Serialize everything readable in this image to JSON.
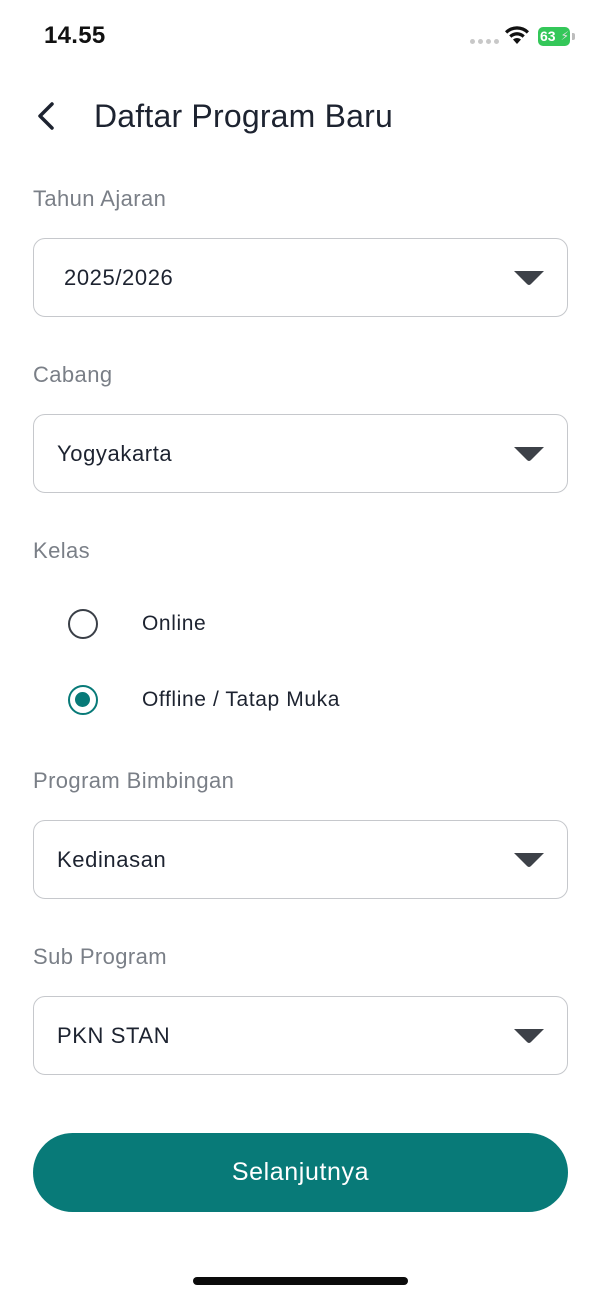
{
  "status_bar": {
    "time": "14.55",
    "battery": "63",
    "icons": [
      "signal-dots-icon",
      "wifi-icon",
      "battery-icon"
    ]
  },
  "header": {
    "back_icon": "chevron-left-icon",
    "title": "Daftar Program Baru"
  },
  "form": {
    "tahun_ajaran": {
      "label": "Tahun Ajaran",
      "value": "2025/2026"
    },
    "cabang": {
      "label": "Cabang",
      "value": "Yogyakarta"
    },
    "kelas": {
      "label": "Kelas",
      "options": [
        {
          "label": "Online",
          "selected": false
        },
        {
          "label": "Offline / Tatap Muka",
          "selected": true
        }
      ]
    },
    "program_bimbingan": {
      "label": "Program Bimbingan",
      "value": "Kedinasan"
    },
    "sub_program": {
      "label": "Sub Program",
      "value": "PKN STAN"
    }
  },
  "actions": {
    "next_label": "Selanjutnya"
  },
  "colors": {
    "accent": "#087a78",
    "label_gray": "#7a7f87",
    "border": "#c6c8cc",
    "battery_green": "#34c759"
  }
}
